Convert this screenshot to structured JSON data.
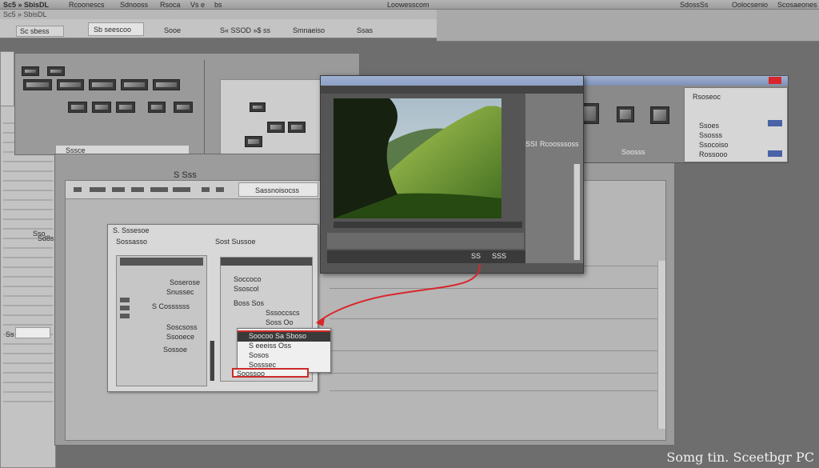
{
  "top_bar": {
    "app_title": "Sc5 » SbisDL",
    "menu_1": "Rcoonescs",
    "menu_2": "Sdnooss",
    "menu_3": "Rsoca",
    "menu_4": "Vs e",
    "menu_5": "bs",
    "center_label": "Loowesscom",
    "right_1": "SdossSs",
    "right_2": "Oolocsenio",
    "right_3": "Scosaeones"
  },
  "toolbar": {
    "tab_1": "Sc sbess",
    "tab_2": "Sb seescoo",
    "tab_3": "Sooe",
    "tab_4": "S« SSOD »$ ss",
    "tab_5": "Smnaeiso",
    "tab_6": "Ssas"
  },
  "left_panel": {
    "small_label": "Ss",
    "side_label": "Sso",
    "left_bottom": "Sd8s",
    "strip_label": "Sssce"
  },
  "back_window": {
    "sub_label": "Sssnoe",
    "center_icon_label": "S Sss"
  },
  "main_window": {
    "toolbar_label": "Sassnoisocss"
  },
  "dialog": {
    "title": "S. Sssesoe",
    "left_header": "Sossasso",
    "right_header": "Sost Sussoe",
    "right_item_1": "Soccoco",
    "right_item_2": "Ssoscol",
    "right_item_3": "Boss Sos",
    "left_items": [
      "Soserose",
      "Snussec",
      "S Cossssss",
      "Soscsoss",
      "Ssooece",
      "Sossoe"
    ],
    "rows_right": [
      "Sssoccscs",
      "Soss Oo"
    ]
  },
  "dropdown": {
    "item_1": "Soocoo Sa Sboso",
    "item_2": "S eeeiss Oss",
    "item_3": "Sosos",
    "item_4": "Sosssec",
    "selected": "Soossoo"
  },
  "video_window": {
    "info_label": "SSI",
    "info_value": "Rcoosssoss",
    "thumb_caption": "Soosss",
    "transport_label": "SS",
    "transport_label_2": "SSS"
  },
  "properties_panel": {
    "header": "Rsoseoc",
    "item_1": "Ssoes",
    "item_2": "Ssosss",
    "item_3": "Ssocoiso",
    "item_4": "Rossooo"
  },
  "watermark": "Somg tin. Sceetbgr PC",
  "colors": {
    "connector": "#d9262b",
    "selection": "#cc2a2a",
    "window_title": "#8da0c6"
  }
}
